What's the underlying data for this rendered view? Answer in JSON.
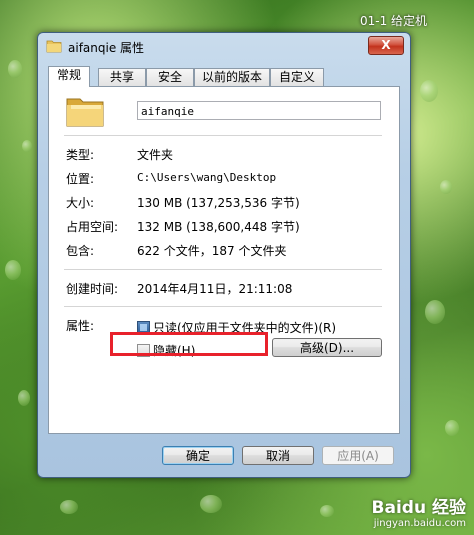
{
  "desktop": {
    "clock_text": "01-1 给定机"
  },
  "window": {
    "title": "aifanqie 属性",
    "close_label": "X",
    "icon": "folder-icon"
  },
  "tabs": [
    {
      "label": "常规",
      "active": true
    },
    {
      "label": "共享",
      "active": false
    },
    {
      "label": "安全",
      "active": false
    },
    {
      "label": "以前的版本",
      "active": false
    },
    {
      "label": "自定义",
      "active": false
    }
  ],
  "general": {
    "name_value": "aifanqie",
    "type": {
      "label": "类型:",
      "value": "文件夹"
    },
    "location": {
      "label": "位置:",
      "value": "C:\\Users\\wang\\Desktop"
    },
    "size": {
      "label": "大小:",
      "value": "130 MB (137,253,536 字节)"
    },
    "size_on_disk": {
      "label": "占用空间:",
      "value": "132 MB (138,600,448 字节)"
    },
    "contains": {
      "label": "包含:",
      "value": "622 个文件，187 个文件夹"
    },
    "created": {
      "label": "创建时间:",
      "value": "2014年4月11日，21:11:08"
    },
    "attributes": {
      "label": "属性:",
      "readonly_label": "只读(仅应用于文件夹中的文件)(R)",
      "readonly_checked": true,
      "hidden_label": "隐藏(H)",
      "hidden_checked": false,
      "advanced_label": "高级(D)..."
    }
  },
  "buttons": {
    "ok": "确定",
    "cancel": "取消",
    "apply": "应用(A)"
  },
  "watermark": {
    "line1": "Baidu 经验",
    "line2": "jingyan.baidu.com"
  },
  "colors": {
    "highlight": "#e8212b",
    "accent": "#3c7fb1"
  }
}
